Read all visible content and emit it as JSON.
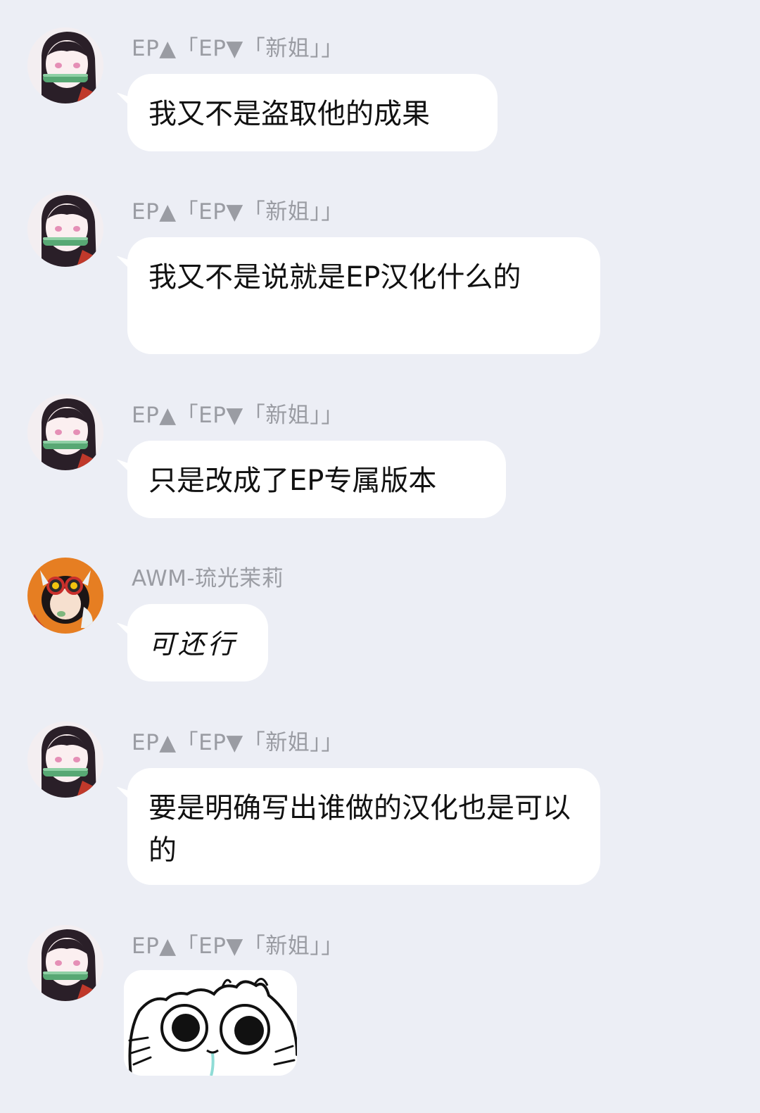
{
  "messages": [
    {
      "sender": "EP▲「EP▼「新姐」」",
      "avatar": "girl-bamboo-avatar",
      "text": "我又不是盗取他的成果"
    },
    {
      "sender": "EP▲「EP▼「新姐」」",
      "avatar": "girl-bamboo-avatar",
      "text": "我又不是说就是EP汉化什么的"
    },
    {
      "sender": "EP▲「EP▼「新姐」」",
      "avatar": "girl-bamboo-avatar",
      "text": "只是改成了EP专属版本"
    },
    {
      "sender": "AWM-琉光茉莉",
      "avatar": "goggles-girl-avatar",
      "text": "可还行"
    },
    {
      "sender": "EP▲「EP▼「新姐」」",
      "avatar": "girl-bamboo-avatar",
      "text": "要是明确写出谁做的汉化也是可以的"
    },
    {
      "sender": "EP▲「EP▼「新姐」」",
      "avatar": "girl-bamboo-avatar",
      "sticker": "staring-cat-sticker"
    }
  ],
  "colors": {
    "background": "#eceef5",
    "bubble": "#ffffff",
    "sender_name": "#9a9ca3",
    "message_text": "#111111"
  }
}
